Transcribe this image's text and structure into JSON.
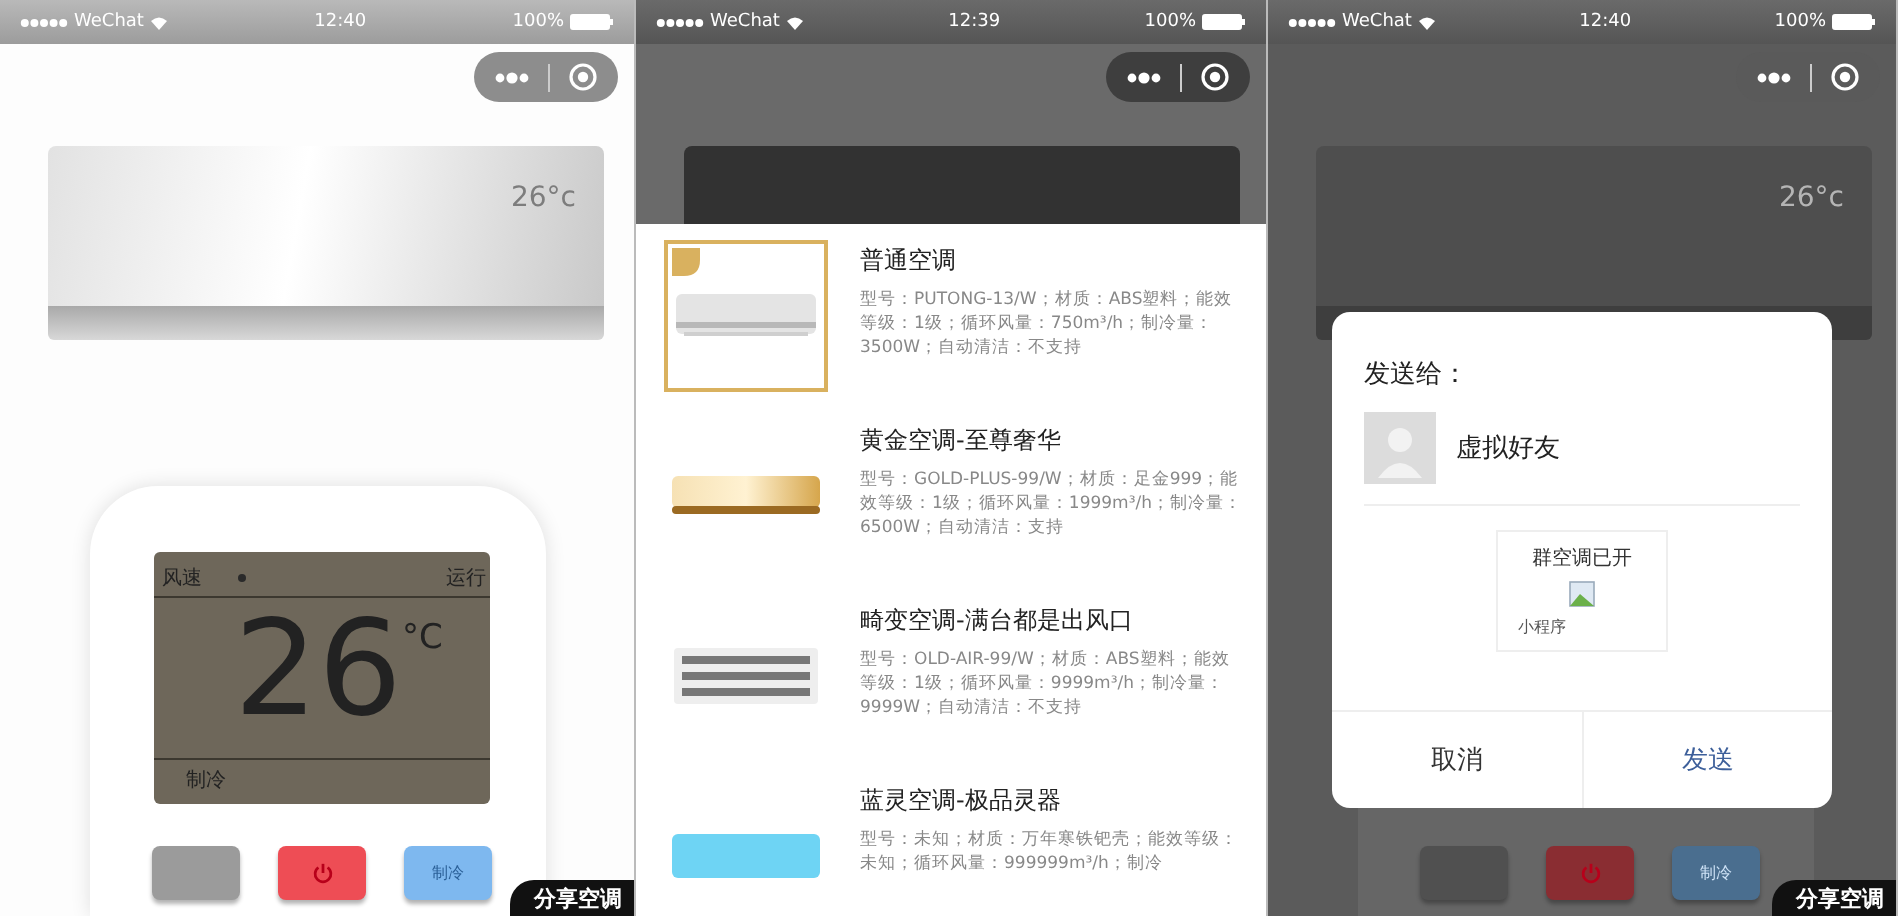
{
  "screens": [
    {
      "kind": "remote",
      "status_bar": {
        "carrier": "WeChat",
        "time": "12:40",
        "battery": "100%"
      },
      "ac_display": "26°c",
      "lcd": {
        "fan_label": "风速",
        "run_label": "运行",
        "temperature": "26",
        "unit": "°C",
        "mode": "制冷"
      },
      "remote_buttons": [
        {
          "kind": "blank"
        },
        {
          "kind": "power"
        },
        {
          "kind": "mode",
          "label": "制冷"
        }
      ],
      "share_badge": "分享空调"
    },
    {
      "kind": "catalog",
      "status_bar": {
        "carrier": "WeChat",
        "time": "12:39",
        "battery": "100%"
      },
      "items": [
        {
          "kind": "white",
          "selected": true,
          "title": "普通空调",
          "desc": "型号：PUTONG-13/W；材质：ABS塑料；能效等级：1级；循环风量：750m³/h；制冷量：3500W；自动清洁：不支持"
        },
        {
          "kind": "gold",
          "selected": false,
          "title": "黄金空调-至尊奢华",
          "desc": "型号：GOLD-PLUS-99/W；材质：足金999；能效等级：1级；循环风量：1999m³/h；制冷量：6500W；自动清洁：支持"
        },
        {
          "kind": "grille",
          "selected": false,
          "title": "畸变空调-满台都是出风口",
          "desc": "型号：OLD-AIR-99/W；材质：ABS塑料；能效等级：1级；循环风量：9999m³/h；制冷量：9999W；自动清洁：不支持"
        },
        {
          "kind": "blue",
          "selected": false,
          "title": "蓝灵空调-极品灵器",
          "desc": "型号：未知；材质：万年寒铁钯壳；能效等级：未知；循环风量：999999m³/h；制冷"
        }
      ]
    },
    {
      "kind": "share",
      "status_bar": {
        "carrier": "WeChat",
        "time": "12:40",
        "battery": "100%"
      },
      "ac_display": "26°c",
      "dialog": {
        "title": "发送给：",
        "contact": "虚拟好友",
        "card_title": "群空调已开",
        "card_footer": "小程序",
        "buttons": [
          {
            "kind": "cancel",
            "label": "取消"
          },
          {
            "kind": "confirm",
            "label": "发送"
          }
        ]
      },
      "remote_buttons": [
        {
          "kind": "blank"
        },
        {
          "kind": "power"
        },
        {
          "kind": "mode",
          "label": "制冷"
        }
      ],
      "share_badge": "分享空调"
    }
  ]
}
